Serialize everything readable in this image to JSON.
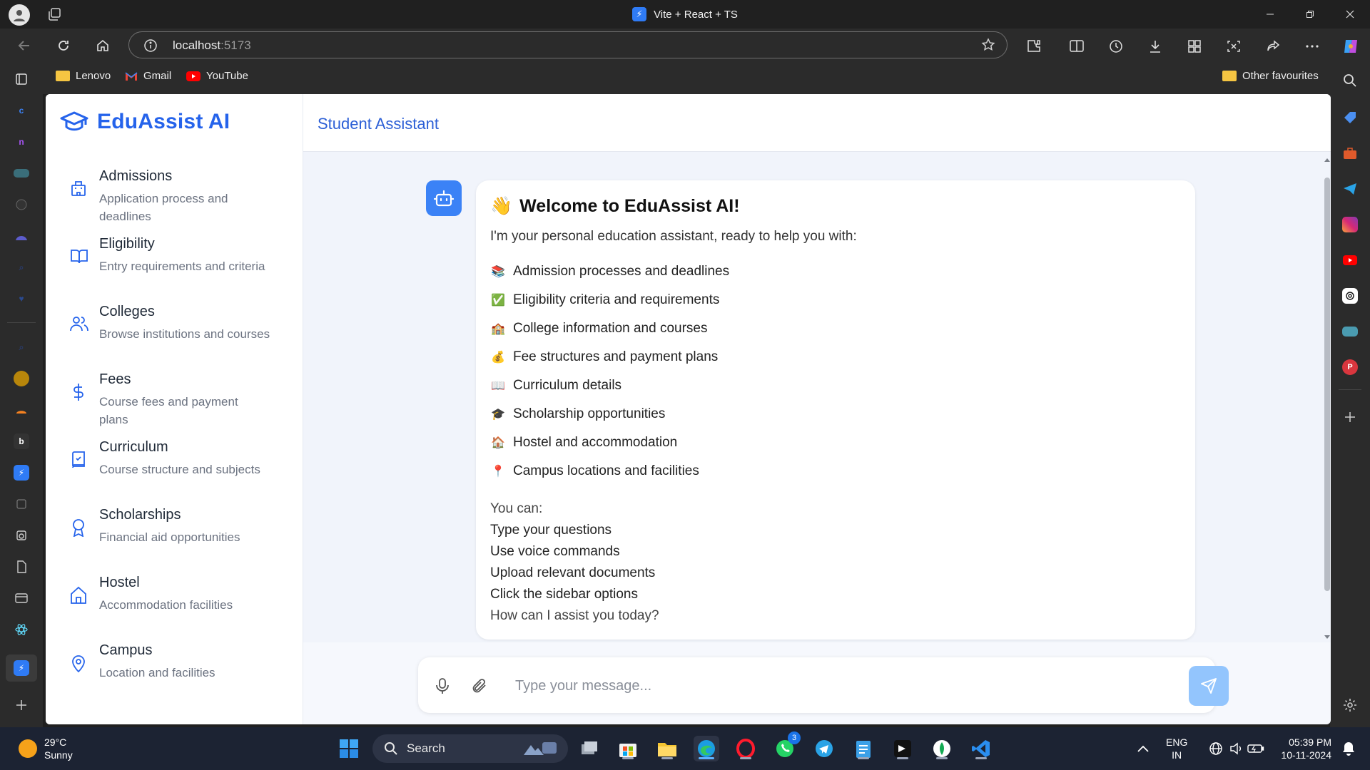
{
  "browser": {
    "tab_title": "Vite + React + TS",
    "url_host": "localhost",
    "url_port": ":5173",
    "favourites": [
      {
        "label": "Lenovo",
        "icon": "folder-icon"
      },
      {
        "label": "Gmail",
        "icon": "gmail-icon"
      },
      {
        "label": "YouTube",
        "icon": "youtube-icon"
      }
    ],
    "other_favourites": "Other favourites"
  },
  "app": {
    "brand": "EduAssist AI",
    "header_title": "Student Assistant",
    "accent_color": "#2563eb",
    "nav": [
      {
        "title": "Admissions",
        "desc": "Application process and deadlines",
        "icon": "building-icon"
      },
      {
        "title": "Eligibility",
        "desc": "Entry requirements and criteria",
        "icon": "book-open-icon"
      },
      {
        "title": "Colleges",
        "desc": "Browse institutions and courses",
        "icon": "users-icon"
      },
      {
        "title": "Fees",
        "desc": "Course fees and payment plans",
        "icon": "dollar-icon"
      },
      {
        "title": "Curriculum",
        "desc": "Course structure and subjects",
        "icon": "book-check-icon"
      },
      {
        "title": "Scholarships",
        "desc": "Financial aid opportunities",
        "icon": "award-icon"
      },
      {
        "title": "Hostel",
        "desc": "Accommodation facilities",
        "icon": "home-icon"
      },
      {
        "title": "Campus",
        "desc": "Location and facilities",
        "icon": "map-pin-icon"
      }
    ],
    "message": {
      "welcome_emoji": "👋",
      "welcome": "Welcome to EduAssist AI!",
      "intro": "I'm your personal education assistant, ready to help you with:",
      "features": [
        {
          "emoji": "📚",
          "text": "Admission processes and deadlines"
        },
        {
          "emoji": "✅",
          "text": "Eligibility criteria and requirements"
        },
        {
          "emoji": "🏫",
          "text": "College information and courses"
        },
        {
          "emoji": "💰",
          "text": "Fee structures and payment plans"
        },
        {
          "emoji": "📖",
          "text": "Curriculum details"
        },
        {
          "emoji": "🎓",
          "text": "Scholarship opportunities"
        },
        {
          "emoji": "🏠",
          "text": "Hostel and accommodation"
        },
        {
          "emoji": "📍",
          "text": "Campus locations and facilities"
        }
      ],
      "you_can": "You can:",
      "actions": [
        "Type your questions",
        "Use voice commands",
        "Upload relevant documents",
        "Click the sidebar options"
      ],
      "closing": "How can I assist you today?"
    },
    "input_placeholder": "Type your message..."
  },
  "taskbar": {
    "temperature": "29°C",
    "weather": "Sunny",
    "search_label": "Search",
    "whatsapp_badge": "3",
    "lang_top": "ENG",
    "lang_bottom": "IN",
    "time": "05:39 PM",
    "date": "10-11-2024"
  }
}
